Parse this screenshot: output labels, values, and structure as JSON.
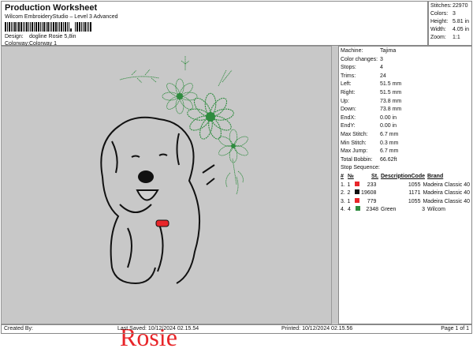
{
  "header": {
    "title": "Production Worksheet",
    "subtitle": "Wilcom EmbroideryStudio – Level 3 Advanced",
    "design_label": "Design:",
    "design_value": "dogline Rosie 5,8in",
    "colorway_label": "Colorway:",
    "colorway_value": "Colorway 1"
  },
  "info": [
    {
      "k": "Stitches:",
      "v": "22970"
    },
    {
      "k": "Colors:",
      "v": "3"
    },
    {
      "k": "Height:",
      "v": "5.81 in"
    },
    {
      "k": "Width:",
      "v": "4.05 in"
    },
    {
      "k": "Zoom:",
      "v": "1:1"
    }
  ],
  "details": [
    {
      "k": "Machine:",
      "v": "Tajima"
    },
    {
      "k": "Color changes:",
      "v": "3"
    },
    {
      "k": "Stops:",
      "v": "4"
    },
    {
      "k": "Trims:",
      "v": "24"
    },
    {
      "k": "Left:",
      "v": "51.5 mm"
    },
    {
      "k": "Right:",
      "v": "51.5 mm"
    },
    {
      "k": "Up:",
      "v": "73.8 mm"
    },
    {
      "k": "Down:",
      "v": "73.8 mm"
    },
    {
      "k": "EndX:",
      "v": "0.00 in"
    },
    {
      "k": "EndY:",
      "v": "0.00 in"
    },
    {
      "k": "Max Stitch:",
      "v": "6.7 mm"
    },
    {
      "k": "Min Stitch:",
      "v": "0.3 mm"
    },
    {
      "k": "Max Jump:",
      "v": "6.7 mm"
    },
    {
      "k": "Total Bobbin:",
      "v": "66.62ft"
    }
  ],
  "stop_sequence": {
    "title": "Stop Sequence:",
    "headers": [
      "#",
      "№",
      "St.",
      "Description",
      "Code",
      "Brand"
    ],
    "rows": [
      {
        "n": "1.",
        "no": "1",
        "color": "#e8262a",
        "st": "233",
        "desc": "",
        "code": "1055",
        "brand": "Madeira Classic 40"
      },
      {
        "n": "2.",
        "no": "2",
        "color": "#111111",
        "st": "19608",
        "desc": "",
        "code": "1171",
        "brand": "Madeira Classic 40"
      },
      {
        "n": "3.",
        "no": "1",
        "color": "#e8262a",
        "st": "779",
        "desc": "",
        "code": "1055",
        "brand": "Madeira Classic 40"
      },
      {
        "n": "4.",
        "no": "4",
        "color": "#2e8b3e",
        "st": "2348",
        "desc": "Green",
        "code": "3",
        "brand": "Wilcom"
      }
    ]
  },
  "design_text": "Rosie",
  "footer": {
    "created": "Created By:",
    "saved": "Last Saved: 10/12/2024 02.15.54",
    "printed": "Printed: 10/12/2024 02.15.56",
    "page": "Page 1 of 1"
  }
}
